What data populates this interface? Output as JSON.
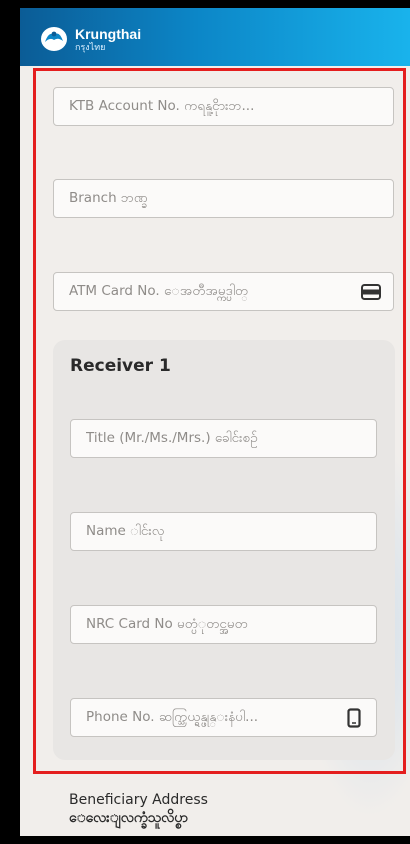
{
  "header": {
    "logo_name": "Krungthai",
    "logo_sub": "กรุงไทย",
    "colors": {
      "gradient_start": "#0b5c96",
      "gradient_end": "#19b3ec"
    }
  },
  "form": {
    "account_placeholder": "KTB Account No. ကရနူ့ငိုားဘ...",
    "branch_placeholder": "Branch ဘဏ္ခ",
    "atm_placeholder": "ATM Card No. ေအတီအမ္ကဒ္ပါတ္",
    "atm_icon": "card-icon"
  },
  "receiver": {
    "title": "Receiver 1",
    "title_field_placeholder": "Title (Mr./Ms./Mrs.) ခေါင်းစဥ်",
    "name_placeholder": "Name ါင်းလု",
    "nrc_placeholder": "NRC Card No မတ္ပံုတင္အမတ",
    "phone_placeholder": "Phone No. ဆက္သြယ္ရန္ဖုန္းနံပါ...",
    "phone_icon": "phone-icon"
  },
  "address": {
    "label": "Beneficiary Address",
    "sub": "ေလေးျလက္ခံသူလိပ္စာ"
  },
  "highlight_color": "#e41e1e"
}
